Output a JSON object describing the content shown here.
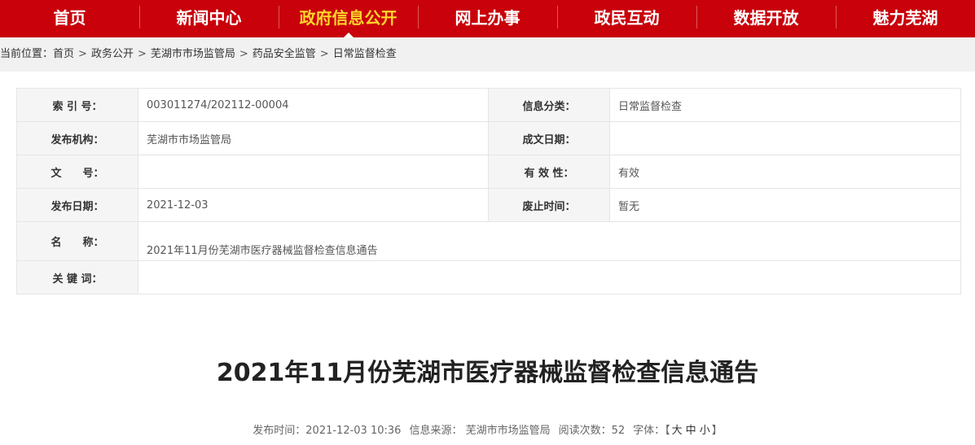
{
  "nav": {
    "items": [
      {
        "label": "首页"
      },
      {
        "label": "新闻中心"
      },
      {
        "label": "政府信息公开"
      },
      {
        "label": "网上办事"
      },
      {
        "label": "政民互动"
      },
      {
        "label": "数据开放"
      },
      {
        "label": "魅力芜湖"
      }
    ],
    "active_index": 2,
    "bg_color": "#c8010a",
    "active_color": "#ffd52a"
  },
  "breadcrumb": {
    "prefix": "当前位置：",
    "items": [
      "首页",
      "政务公开",
      "芜湖市市场监管局",
      "药品安全监管",
      "日常监督检查"
    ],
    "separator": ">"
  },
  "meta": {
    "index_label": "索 引 号：",
    "index_value": "003011274/202112-00004",
    "category_label": "信息分类：",
    "category_value": "日常监督检查",
    "publisher_label": "发布机构：",
    "publisher_value": "芜湖市市场监管局",
    "created_label": "成文日期：",
    "created_value": "",
    "docno_label": "文　　号：",
    "docno_value": "",
    "validity_label": "有 效 性：",
    "validity_value": "有效",
    "pubdate_label": "发布日期：",
    "pubdate_value": "2021-12-03",
    "abolish_label": "废止时间：",
    "abolish_value": "暂无",
    "name_label": "名　　称：",
    "name_value": "2021年11月份芜湖市医疗器械监督检查信息通告",
    "keywords_label": "关 键 词：",
    "keywords_value": ""
  },
  "article": {
    "title": "2021年11月份芜湖市医疗器械监督检查信息通告",
    "pubtime": "发布时间：2021-12-03 10:36",
    "source": "信息来源： 芜湖市市场监管局",
    "views": "阅读次数：52",
    "font_label": "字体：",
    "font_open": "【",
    "font_large": "大",
    "font_medium": "中",
    "font_small": "小",
    "font_close": "】"
  }
}
